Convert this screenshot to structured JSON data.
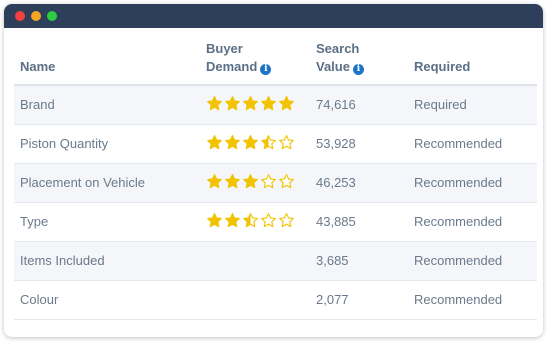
{
  "headers": {
    "name": "Name",
    "demand_line1": "Buyer",
    "demand_line2": "Demand",
    "search_line1": "Search",
    "search_line2": "Value",
    "required": "Required",
    "info_glyph": "i"
  },
  "colors": {
    "titlebar": "#2d3f5a",
    "star": "#f2c300",
    "info": "#1d74c7"
  },
  "rows": [
    {
      "name": "Brand",
      "rating": 5,
      "value": "74,616",
      "status": "Required"
    },
    {
      "name": "Piston Quantity",
      "rating": 3.5,
      "value": "53,928",
      "status": "Recommended"
    },
    {
      "name": "Placement on Vehicle",
      "rating": 3,
      "value": "46,253",
      "status": "Recommended"
    },
    {
      "name": "Type",
      "rating": 2.5,
      "value": "43,885",
      "status": "Recommended"
    },
    {
      "name": "Items Included",
      "rating": 0,
      "value": "3,685",
      "status": "Recommended"
    },
    {
      "name": "Colour",
      "rating": 0,
      "value": "2,077",
      "status": "Recommended"
    }
  ]
}
